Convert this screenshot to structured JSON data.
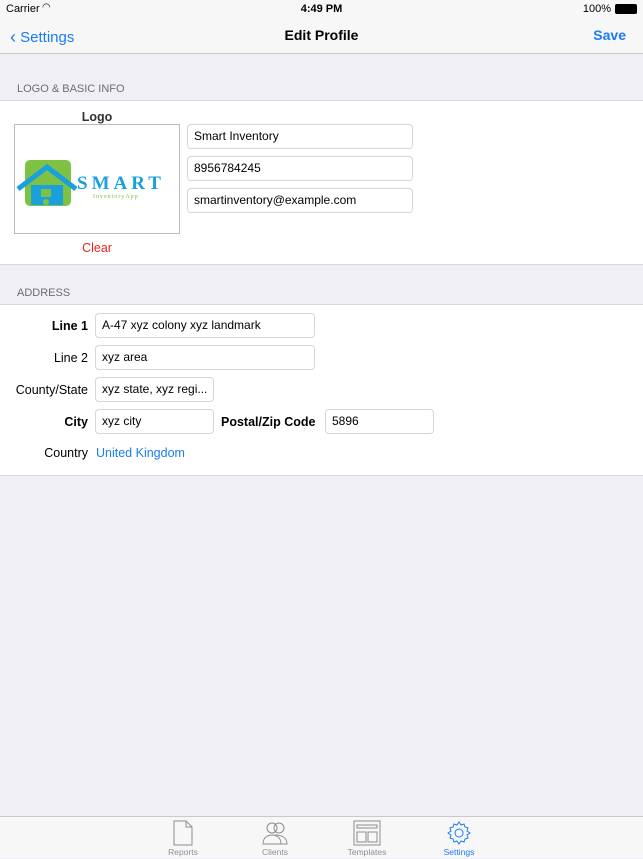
{
  "status": {
    "carrier": "Carrier",
    "time": "4:49 PM",
    "battery": "100%"
  },
  "nav": {
    "back": "Settings",
    "title": "Edit Profile",
    "save": "Save"
  },
  "basic": {
    "header": "LOGO & BASIC INFO",
    "logo_label": "Logo",
    "clear": "Clear",
    "logo_text": "SMART",
    "logo_sub": "InventoryApp",
    "name": "Smart Inventory",
    "phone": "8956784245",
    "email": "smartinventory@example.com"
  },
  "address": {
    "header": "ADDRESS",
    "line1_label": "Line 1",
    "line1": "A-47 xyz colony xyz landmark",
    "line2_label": "Line 2",
    "line2": "xyz area",
    "state_label": "County/State",
    "state": "xyz state, xyz regi...",
    "city_label": "City",
    "city": "xyz city",
    "zip_label": "Postal/Zip Code",
    "zip": "5896",
    "country_label": "Country",
    "country": "United Kingdom"
  },
  "tabs": [
    {
      "label": "Reports",
      "icon": "document-icon"
    },
    {
      "label": "Clients",
      "icon": "people-icon"
    },
    {
      "label": "Templates",
      "icon": "layout-icon"
    },
    {
      "label": "Settings",
      "icon": "gear-icon",
      "active": true
    }
  ],
  "colors": {
    "accent": "#1a7cf5",
    "destructive": "#e8231b"
  }
}
